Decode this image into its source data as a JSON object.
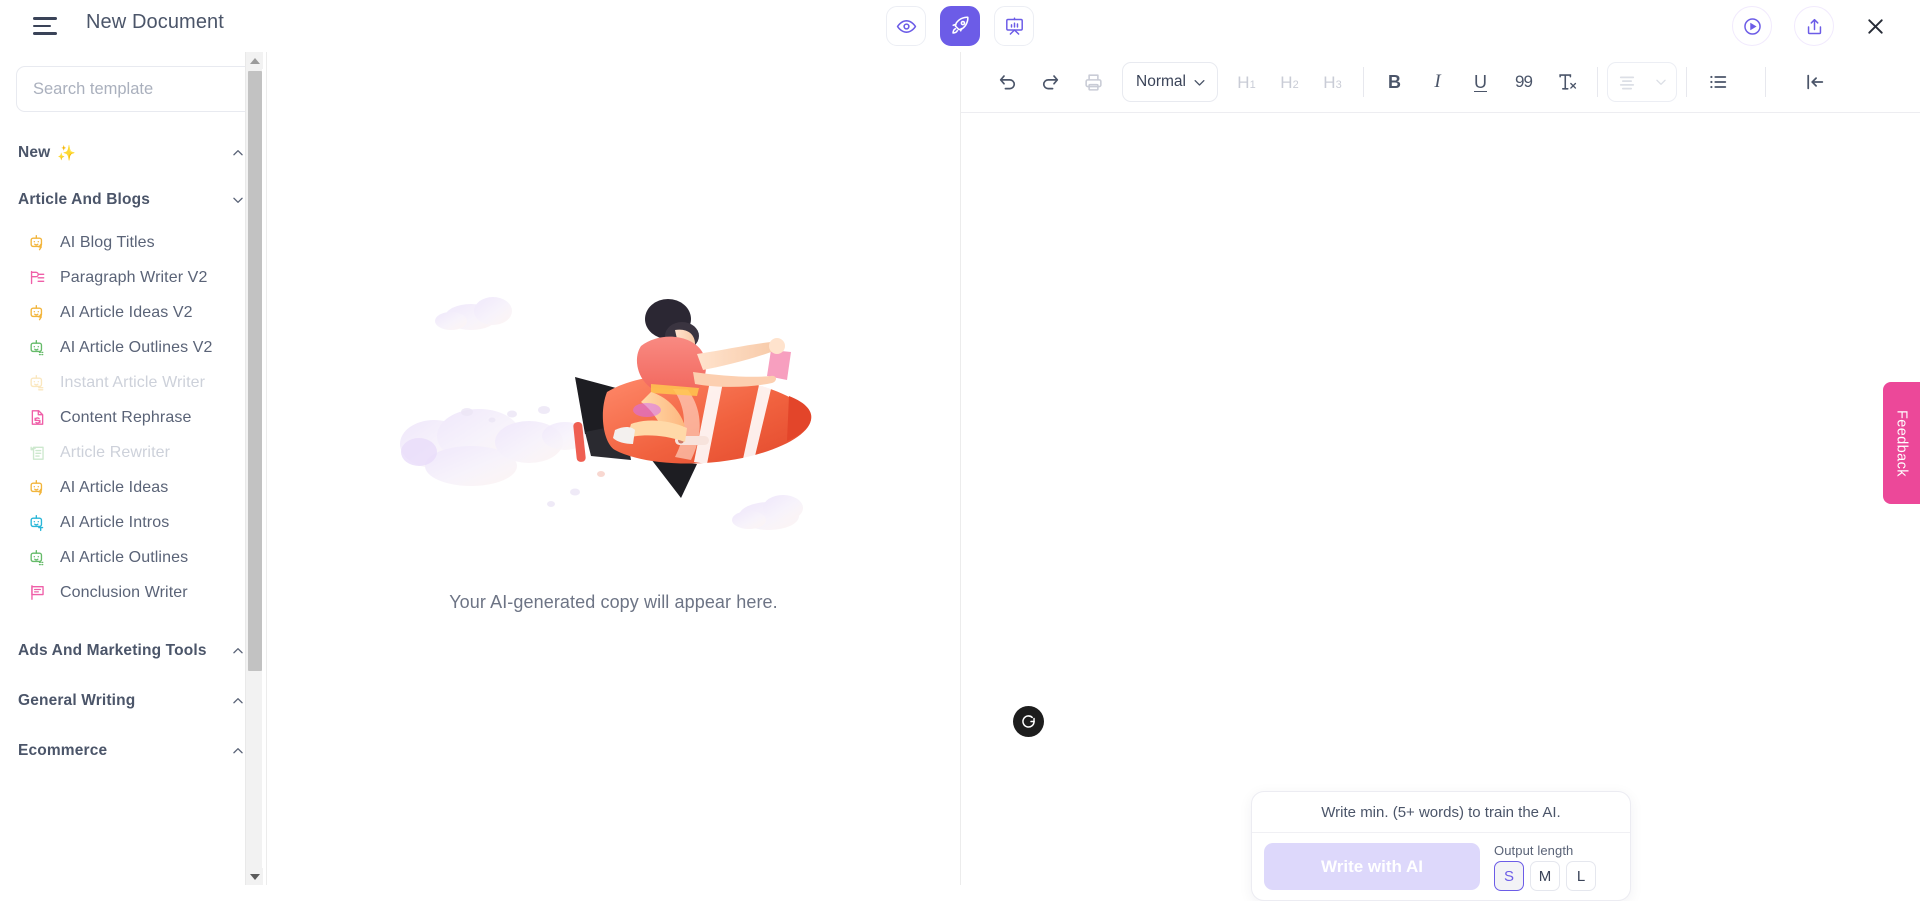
{
  "header": {
    "menu_icon": "hamburger-icon",
    "title": "New Document",
    "center_tools": [
      {
        "name": "preview",
        "icon": "eye-icon",
        "active": false
      },
      {
        "name": "generate",
        "icon": "rocket-icon",
        "active": true
      },
      {
        "name": "presentation",
        "icon": "presentation-chart-icon",
        "active": false
      }
    ],
    "right_tools": [
      {
        "name": "play",
        "icon": "play-circle-icon"
      },
      {
        "name": "share",
        "icon": "share-upload-icon"
      },
      {
        "name": "close",
        "icon": "close-x-icon"
      }
    ]
  },
  "sidebar": {
    "search": {
      "placeholder": "Search template",
      "value": "",
      "icon": "search-icon"
    },
    "sections": [
      {
        "label": "New",
        "sparkle": "✨",
        "chevron": "chevron-up-icon",
        "expanded": true
      },
      {
        "label": "Article And Blogs",
        "chevron": "chevron-down-icon",
        "expanded": false
      }
    ],
    "templates": [
      {
        "label": "AI Blog Titles",
        "icon": "robot-bolt-icon",
        "color": "#f2b53c",
        "disabled": false
      },
      {
        "label": "Paragraph Writer V2",
        "icon": "paragraph-lines-icon",
        "color": "#ef5fa8",
        "disabled": false
      },
      {
        "label": "AI Article Ideas V2",
        "icon": "robot-bolt-icon",
        "color": "#f2b53c",
        "disabled": false
      },
      {
        "label": "AI Article Outlines V2",
        "icon": "robot-outline-icon",
        "color": "#66bb6a",
        "disabled": false
      },
      {
        "label": "Instant Article Writer",
        "icon": "robot-lines-icon",
        "color": "#f2b53c",
        "disabled": true
      },
      {
        "label": "Content Rephrase",
        "icon": "doc-refresh-icon",
        "color": "#ef5fa8",
        "disabled": false
      },
      {
        "label": "Article Rewriter",
        "icon": "doc-rewrite-icon",
        "color": "#66bb6a",
        "disabled": true
      },
      {
        "label": "AI Article Ideas",
        "icon": "robot-bolt-icon",
        "color": "#f2b53c",
        "disabled": false
      },
      {
        "label": "AI Article Intros",
        "icon": "robot-text-icon",
        "color": "#29b6d8",
        "disabled": false
      },
      {
        "label": "AI Article Outlines",
        "icon": "robot-outline-icon",
        "color": "#66bb6a",
        "disabled": false
      },
      {
        "label": "Conclusion Writer",
        "icon": "flag-text-icon",
        "color": "#ef5fa8",
        "disabled": false
      }
    ],
    "bottom_sections": [
      {
        "label": "Ads And Marketing Tools",
        "chevron": "chevron-up-icon"
      },
      {
        "label": "General Writing",
        "chevron": "chevron-up-icon"
      },
      {
        "label": "Ecommerce",
        "chevron": "chevron-up-icon"
      }
    ],
    "scrollbar": {
      "up_arrow": "scroll-up-arrow-icon",
      "down_arrow": "scroll-down-arrow-icon"
    }
  },
  "preview": {
    "illustration": "rocket-rider-clouds-illustration",
    "caption": "Your AI-generated copy will appear here."
  },
  "editor": {
    "toolbar": {
      "undo": {
        "label": "Undo",
        "icon": "undo-arrow-icon"
      },
      "redo": {
        "label": "Redo",
        "icon": "redo-arrow-icon"
      },
      "print": {
        "label": "Print",
        "icon": "printer-icon"
      },
      "style_select": {
        "value": "Normal",
        "chevron": "chevron-down-icon"
      },
      "headings": [
        {
          "label": "H",
          "sub": "1",
          "disabled": true
        },
        {
          "label": "H",
          "sub": "2",
          "disabled": true
        },
        {
          "label": "H",
          "sub": "3",
          "disabled": true
        }
      ],
      "bold": {
        "label": "B",
        "icon": "bold-icon"
      },
      "italic": {
        "label": "I",
        "icon": "italic-icon"
      },
      "underline": {
        "label": "U",
        "icon": "underline-icon"
      },
      "quote": {
        "label": "99",
        "icon": "blockquote-icon"
      },
      "clear_format": {
        "label": "Tx",
        "icon": "clear-format-icon"
      },
      "align_select": {
        "icon": "align-center-icon",
        "chevron": "chevron-down-icon",
        "disabled": true
      },
      "bullet_list": {
        "icon": "bullet-list-icon"
      },
      "collapse": {
        "icon": "collapse-left-arrow-icon"
      }
    },
    "badge": {
      "letter": "G",
      "name": "grammarly-badge"
    }
  },
  "ai_panel": {
    "hint": "Write min. (5+ words) to train the AI.",
    "write_button": "Write with AI",
    "output_length_label": "Output length",
    "lengths": [
      {
        "label": "S",
        "selected": true
      },
      {
        "label": "M",
        "selected": false
      },
      {
        "label": "L",
        "selected": false
      }
    ]
  },
  "feedback": {
    "label": "Feedback"
  },
  "colors": {
    "accent_purple": "#6c5ce7",
    "feedback_pink": "#ec4899",
    "text_primary": "#4b5569",
    "text_muted": "#aab0bd",
    "border": "#e8eaf0"
  }
}
